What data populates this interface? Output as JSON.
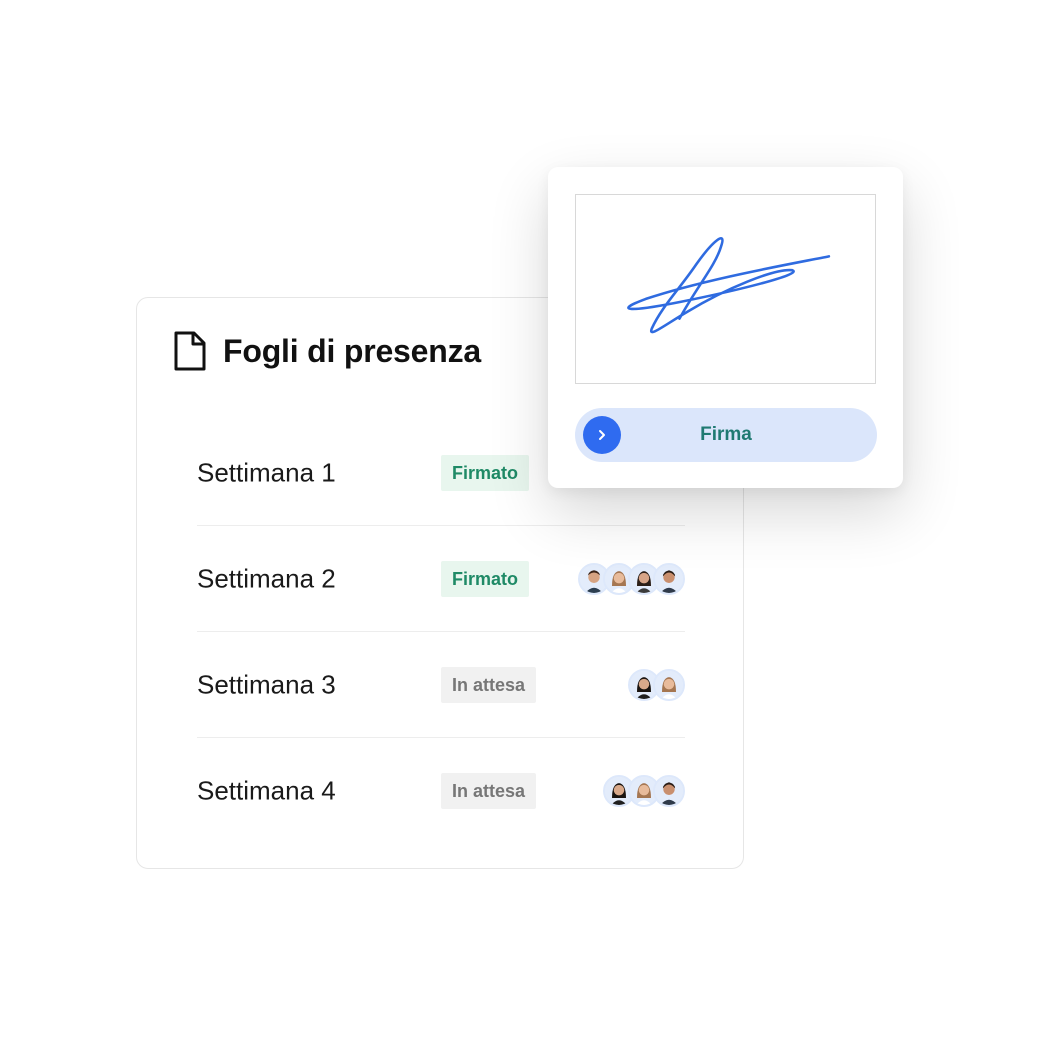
{
  "card": {
    "title": "Fogli di presenza",
    "icon": "document-icon",
    "rows": [
      {
        "label": "Settimana 1",
        "status": "Firmato",
        "state": "signed",
        "avatars": 0
      },
      {
        "label": "Settimana 2",
        "status": "Firmato",
        "state": "signed",
        "avatars": 4
      },
      {
        "label": "Settimana 3",
        "status": "In attesa",
        "state": "pending",
        "avatars": 2
      },
      {
        "label": "Settimana 4",
        "status": "In attesa",
        "state": "pending",
        "avatars": 3
      }
    ]
  },
  "sign_panel": {
    "button_label": "Firma",
    "button_icon": "chevron-right-icon"
  },
  "colors": {
    "signed_text": "#1f8a66",
    "signed_bg": "#e8f6ee",
    "pending_text": "#777777",
    "pending_bg": "#f1f1f1",
    "accent_blue": "#2f6bf0",
    "signature_stroke": "#2f6be0",
    "button_bg": "#dbe6fb"
  }
}
